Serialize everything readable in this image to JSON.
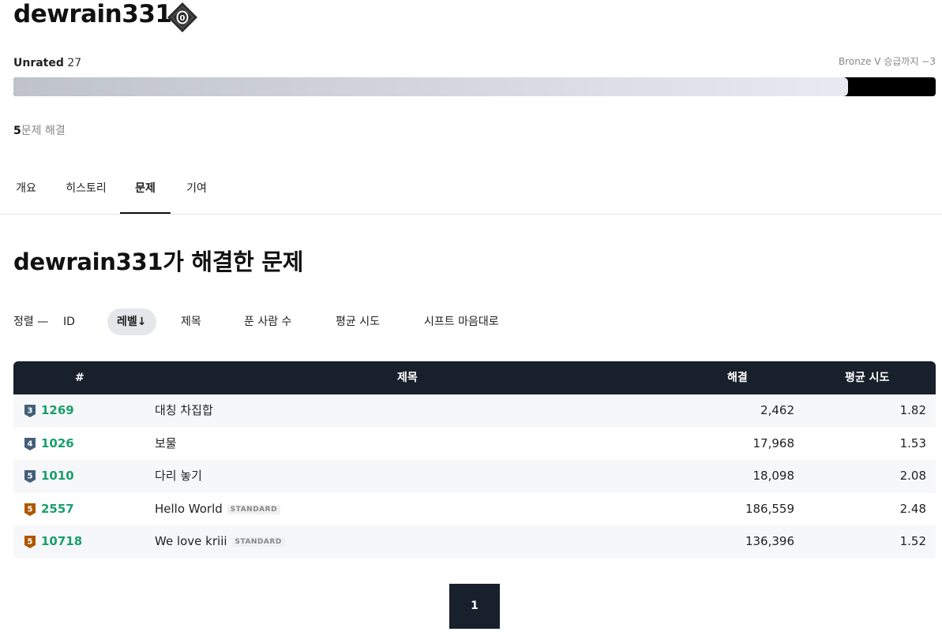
{
  "profile": {
    "username": "dewrain331",
    "tier_badge_number": "0",
    "rating_label": "Unrated",
    "rating_value": "27",
    "promotion_text": "Bronze V 승급까지 −3",
    "progress_percent": 90.5,
    "solved_count": "5",
    "solved_suffix": "문제 해결"
  },
  "tabs": [
    {
      "label": "개요",
      "active": false
    },
    {
      "label": "히스토리",
      "active": false
    },
    {
      "label": "문제",
      "active": true
    },
    {
      "label": "기여",
      "active": false
    }
  ],
  "section": {
    "title": "dewrain331가 해결한 문제"
  },
  "sort": {
    "label": "정렬 —",
    "options": [
      {
        "label": "ID",
        "active": false
      },
      {
        "label": "레벨",
        "active": true,
        "arrow": "↓"
      },
      {
        "label": "제목",
        "active": false
      },
      {
        "label": "푼 사람 수",
        "active": false
      },
      {
        "label": "평균 시도",
        "active": false
      },
      {
        "label": "시프트 마음대로",
        "active": false
      }
    ]
  },
  "table": {
    "headers": {
      "id": "#",
      "title": "제목",
      "solved": "해결",
      "avg": "평균 시도"
    },
    "rows": [
      {
        "level": "3",
        "tier": "silver",
        "id": "1269",
        "title": "대칭 차집합",
        "tag": "",
        "solved": "2,462",
        "avg": "1.82"
      },
      {
        "level": "4",
        "tier": "silver",
        "id": "1026",
        "title": "보물",
        "tag": "",
        "solved": "17,968",
        "avg": "1.53"
      },
      {
        "level": "5",
        "tier": "silver",
        "id": "1010",
        "title": "다리 놓기",
        "tag": "",
        "solved": "18,098",
        "avg": "2.08"
      },
      {
        "level": "5",
        "tier": "bronze",
        "id": "2557",
        "title": "Hello World",
        "tag": "STANDARD",
        "solved": "186,559",
        "avg": "2.48"
      },
      {
        "level": "5",
        "tier": "bronze",
        "id": "10718",
        "title": "We love kriii",
        "tag": "STANDARD",
        "solved": "136,396",
        "avg": "1.52"
      }
    ]
  },
  "pagination": {
    "current": "1"
  },
  "colors": {
    "silver_icon": "#435f7a",
    "bronze_icon": "#ad5600",
    "problem_id": "#1a9f6b",
    "header_bg": "#17202b"
  },
  "icons": {
    "tier_badge": "unrated-diamond-icon",
    "level": "tier-shield-icon"
  }
}
